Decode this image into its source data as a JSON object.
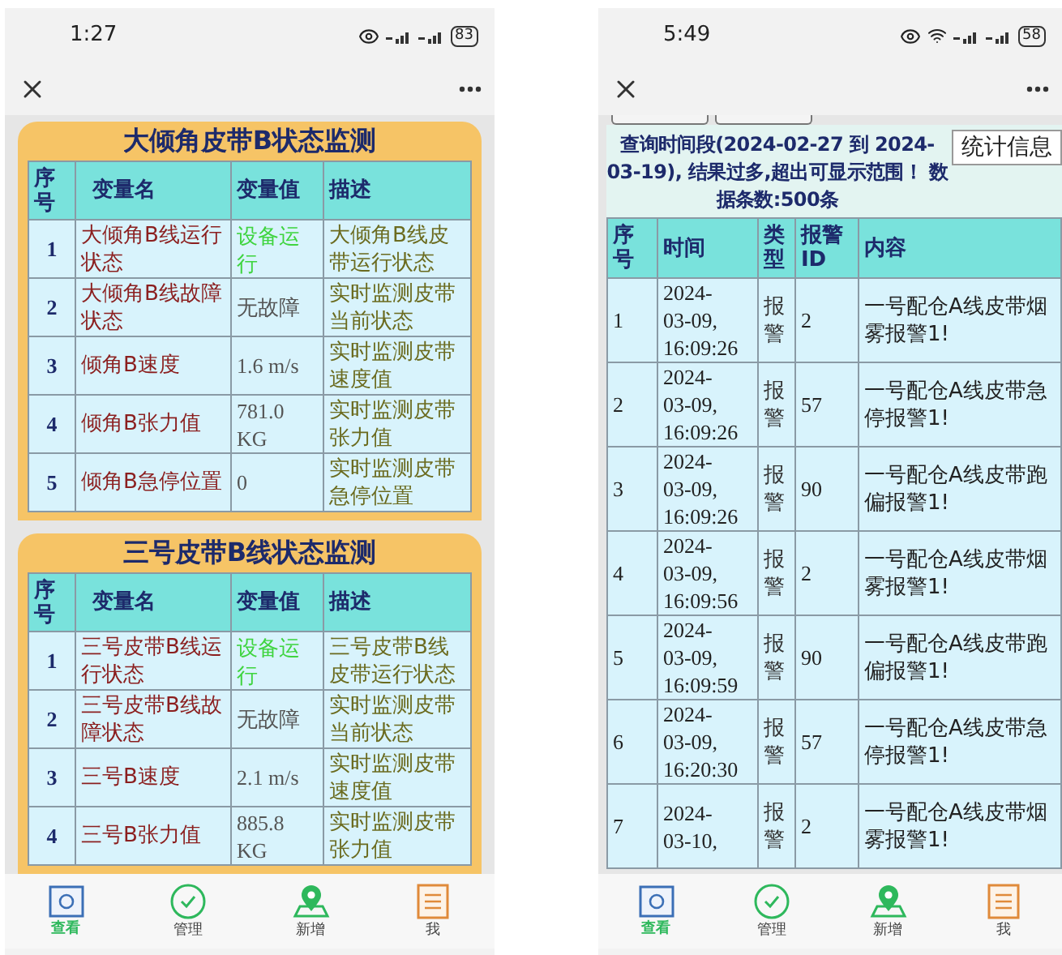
{
  "phones": [
    {
      "kind": "monitor",
      "status_bar": {
        "time": "1:27",
        "wifi": false,
        "battery": "83"
      },
      "cards": [
        {
          "title": "大倾角皮带B状态监测",
          "columns": [
            "序号",
            "变量名",
            "变量值",
            "描述"
          ],
          "rows": [
            {
              "index": "1",
              "name": "大倾角B线运行状态",
              "value": "设备运行",
              "running": true,
              "description": "大倾角B线皮带运行状态"
            },
            {
              "index": "2",
              "name": "大倾角B线故障状态",
              "value": "无故障",
              "running": false,
              "description": "实时监测皮带当前状态"
            },
            {
              "index": "3",
              "name": "倾角B速度",
              "value": "1.6 m/s",
              "running": false,
              "description": "实时监测皮带速度值"
            },
            {
              "index": "4",
              "name": "倾角B张力值",
              "value": "781.0 KG",
              "running": false,
              "description": "实时监测皮带张力值"
            },
            {
              "index": "5",
              "name": "倾角B急停位置",
              "value": "0",
              "running": false,
              "description": "实时监测皮带急停位置"
            }
          ]
        },
        {
          "title": "三号皮带B线状态监测",
          "columns": [
            "序号",
            "变量名",
            "变量值",
            "描述"
          ],
          "rows": [
            {
              "index": "1",
              "name": "三号皮带B线运行状态",
              "value": "设备运行",
              "running": true,
              "description": "三号皮带B线皮带运行状态"
            },
            {
              "index": "2",
              "name": "三号皮带B线故障状态",
              "value": "无故障",
              "running": false,
              "description": "实时监测皮带当前状态"
            },
            {
              "index": "3",
              "name": "三号B速度",
              "value": "2.1 m/s",
              "running": false,
              "description": "实时监测皮带速度值"
            },
            {
              "index": "4",
              "name": "三号B张力值",
              "value": "885.8 KG",
              "running": false,
              "description": "实时监测皮带张力值"
            }
          ]
        }
      ],
      "tabs": [
        {
          "label": "查看",
          "selected": true
        },
        {
          "label": "管理",
          "selected": false
        },
        {
          "label": "新增",
          "selected": false
        },
        {
          "label": "我",
          "selected": false
        }
      ]
    },
    {
      "kind": "alarms",
      "status_bar": {
        "time": "5:49",
        "wifi": true,
        "battery": "58"
      },
      "stats_button": "统计信息",
      "query_text": "查询时间段(2024-02-27 到 2024-03-19), 结果过多,超出可显示范围！ 数据条数:500条",
      "columns": [
        "序号",
        "时间",
        "类型",
        "报警ID",
        "内容"
      ],
      "rows": [
        {
          "index": "1",
          "time": [
            "2024-",
            "03-09,",
            "16:09:26"
          ],
          "type": "报警",
          "alarm_id": "2",
          "content": "一号配仓A线皮带烟雾报警1!"
        },
        {
          "index": "2",
          "time": [
            "2024-",
            "03-09,",
            "16:09:26"
          ],
          "type": "报警",
          "alarm_id": "57",
          "content": "一号配仓A线皮带急停报警1!"
        },
        {
          "index": "3",
          "time": [
            "2024-",
            "03-09,",
            "16:09:26"
          ],
          "type": "报警",
          "alarm_id": "90",
          "content": "一号配仓A线皮带跑偏报警1!"
        },
        {
          "index": "4",
          "time": [
            "2024-",
            "03-09,",
            "16:09:56"
          ],
          "type": "报警",
          "alarm_id": "2",
          "content": "一号配仓A线皮带烟雾报警1!"
        },
        {
          "index": "5",
          "time": [
            "2024-",
            "03-09,",
            "16:09:59"
          ],
          "type": "报警",
          "alarm_id": "90",
          "content": "一号配仓A线皮带跑偏报警1!"
        },
        {
          "index": "6",
          "time": [
            "2024-",
            "03-09,",
            "16:20:30"
          ],
          "type": "报警",
          "alarm_id": "57",
          "content": "一号配仓A线皮带急停报警1!"
        },
        {
          "index": "7",
          "time": [
            "2024-",
            "03-10,"
          ],
          "type": "报警",
          "alarm_id": "2",
          "content": "一号配仓A线皮带烟雾报警1!"
        }
      ],
      "tabs": [
        {
          "label": "查看",
          "selected": true
        },
        {
          "label": "管理",
          "selected": false
        },
        {
          "label": "新增",
          "selected": false
        },
        {
          "label": "我",
          "selected": false
        }
      ]
    }
  ]
}
